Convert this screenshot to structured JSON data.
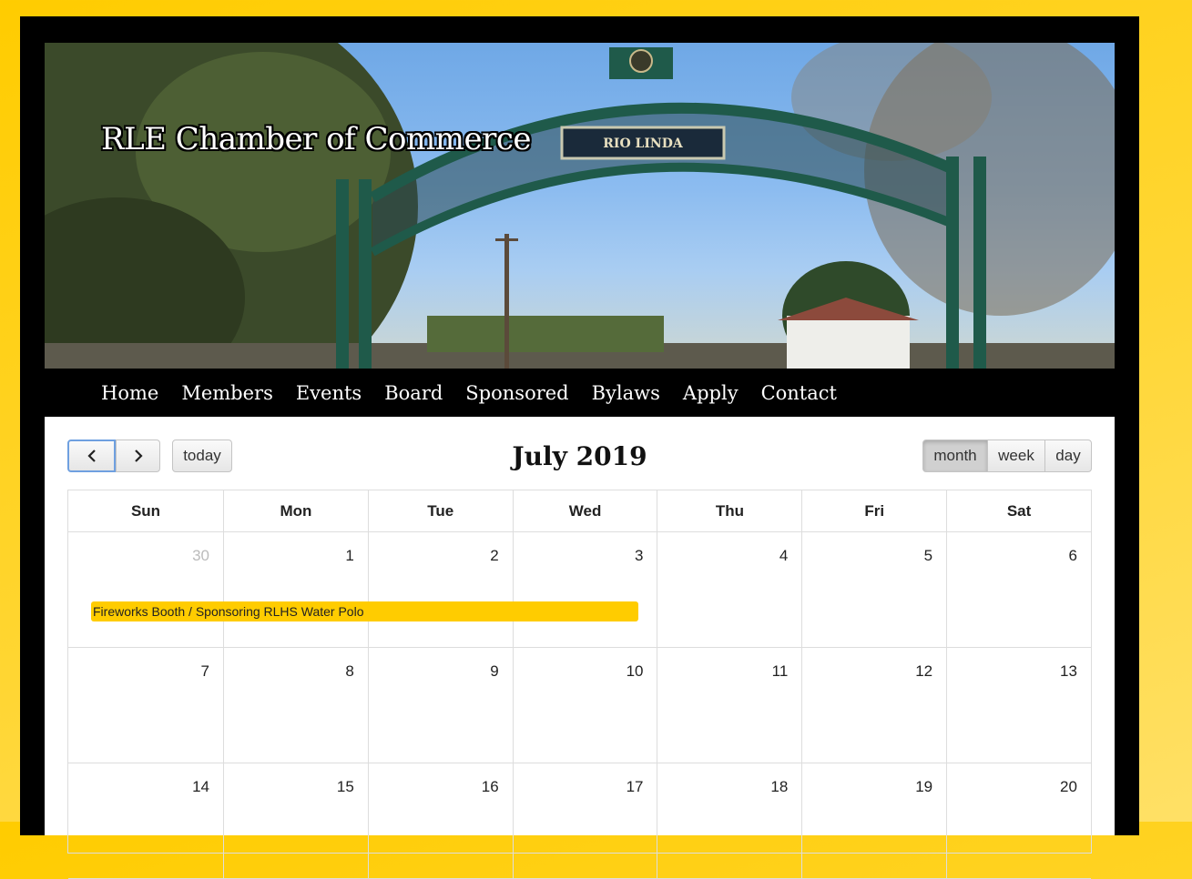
{
  "site": {
    "title": "RLE Chamber of Commerce",
    "sign_text": "RIO LINDA"
  },
  "nav": {
    "items": [
      {
        "label": "Home"
      },
      {
        "label": "Members"
      },
      {
        "label": "Events"
      },
      {
        "label": "Board"
      },
      {
        "label": "Sponsored"
      },
      {
        "label": "Bylaws"
      },
      {
        "label": "Apply"
      },
      {
        "label": "Contact"
      }
    ]
  },
  "calendar": {
    "title": "July 2019",
    "today_label": "today",
    "views": {
      "month": "month",
      "week": "week",
      "day": "day"
    },
    "active_view": "month",
    "day_headers": [
      "Sun",
      "Mon",
      "Tue",
      "Wed",
      "Thu",
      "Fri",
      "Sat"
    ],
    "weeks": [
      [
        "30",
        "1",
        "2",
        "3",
        "4",
        "5",
        "6"
      ],
      [
        "7",
        "8",
        "9",
        "10",
        "11",
        "12",
        "13"
      ],
      [
        "14",
        "15",
        "16",
        "17",
        "18",
        "19",
        "20"
      ]
    ],
    "event": {
      "title": "Fireworks Booth / Sponsoring RLHS Water Polo",
      "color": "#ffcc00"
    }
  },
  "colors": {
    "background": "#ffcc00",
    "frame": "#000000"
  }
}
